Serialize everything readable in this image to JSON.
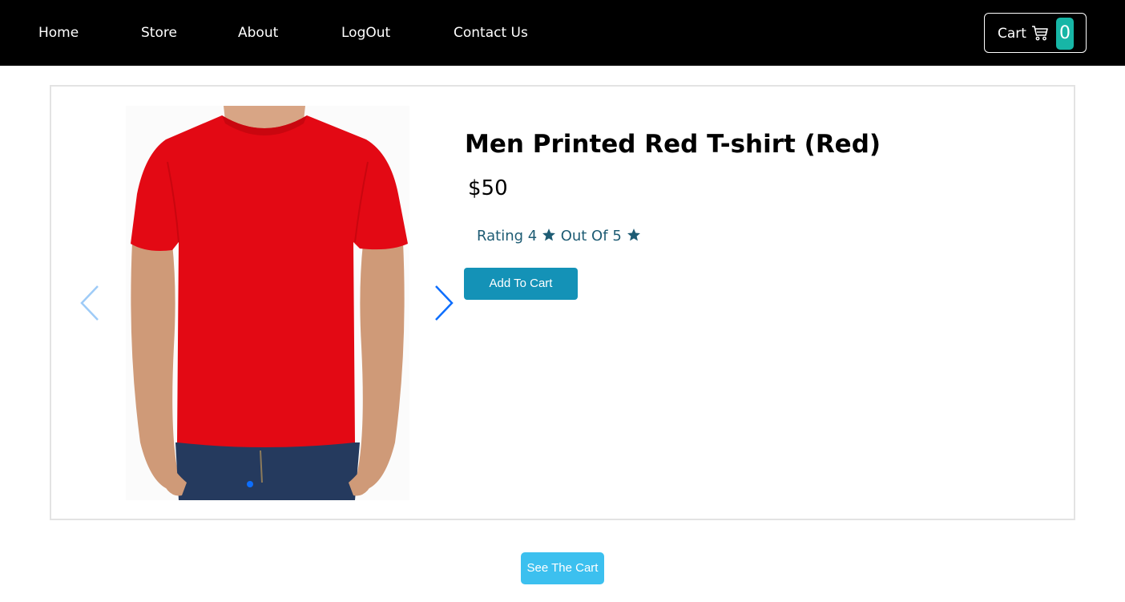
{
  "navbar": {
    "links": [
      "Home",
      "Store",
      "About",
      "LogOut",
      "Contact Us"
    ],
    "cart": {
      "label": "Cart",
      "count": "0",
      "icon": "shopping-cart-icon"
    },
    "colors": {
      "background": "#000000",
      "badge": "#17b6a6"
    }
  },
  "product": {
    "title": "Men Printed Red T-shirt (Red)",
    "price": "$50",
    "rating": {
      "prefix": "Rating",
      "value": "4",
      "middle": "Out Of",
      "max": "5",
      "icon": "star-icon"
    },
    "add_to_cart_label": "Add To Cart",
    "image": {
      "subject": "man wearing red t-shirt and jeans",
      "color": "#e30914"
    },
    "carousel": {
      "prev_icon": "chevron-left-icon",
      "next_icon": "chevron-right-icon",
      "active_slide": 1,
      "slide_count": 1
    }
  },
  "footer": {
    "see_cart_label": "See The Cart"
  },
  "colors": {
    "accent": "#1492b7",
    "rating_text": "#1e5c74",
    "see_cart": "#3cc0ef",
    "carousel_control": "#0d6efd"
  }
}
